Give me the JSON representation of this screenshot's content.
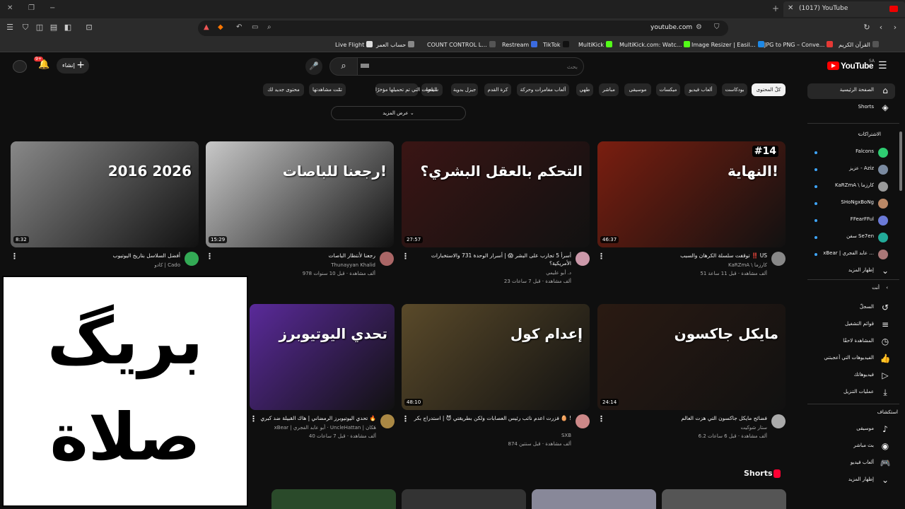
{
  "browser": {
    "tab_title": "(1017) YouTube",
    "url": "youtube.com",
    "bookmarks": [
      {
        "label": "Live Flight",
        "color": "#ddd"
      },
      {
        "label": "حساب العمر",
        "color": "#888"
      },
      {
        "label": "COUNT CONTROL L...",
        "color": "#555"
      },
      {
        "label": "Restream",
        "color": "#3b6be0"
      },
      {
        "label": "TikTok",
        "color": "#111"
      },
      {
        "label": "MultiKick",
        "color": "#53fc18"
      },
      {
        "label": "MultiKick.com: Watc...",
        "color": "#53fc18"
      },
      {
        "label": "Image Resizer | Easil...",
        "color": "#1e88e5"
      },
      {
        "label": "JPG to PNG – Conve...",
        "color": "#e53935"
      },
      {
        "label": "القرآن الكريم",
        "color": "#555"
      }
    ]
  },
  "header": {
    "notif_count": "9+",
    "create_label": "إنشاء",
    "search_placeholder": "بحث",
    "logo_text": "YouTube",
    "country_code": "SA"
  },
  "chips": [
    {
      "label": "كلّ المحتوى",
      "active": true
    },
    {
      "label": "بودكاست"
    },
    {
      "label": "ألعاب فيديو"
    },
    {
      "label": "ميكسات"
    },
    {
      "label": "موسيقى"
    },
    {
      "label": "مباشر"
    },
    {
      "label": "طهي"
    },
    {
      "label": "ألعاب مغامرات وحركة"
    },
    {
      "label": "كرة القدم"
    },
    {
      "label": "جيزل بدوية"
    },
    {
      "label": "سياحة"
    },
    {
      "label": "الفنوات التي تم تحميلها مؤخرًا"
    },
    {
      "label": "تمّت مشاهدتها"
    },
    {
      "label": "محتوى جديد لك"
    }
  ],
  "more_label": "عرض المزيد",
  "sidebar": {
    "main": [
      {
        "label": "الصفحة الرئيسية",
        "icon": "home-icon",
        "glyph": "⌂"
      },
      {
        "label": "Shorts",
        "icon": "shorts-icon",
        "glyph": "◈"
      }
    ],
    "subs_title": "الاشتراكات",
    "subscriptions": [
      {
        "label": "Falcons",
        "color": "#2ecc71"
      },
      {
        "label": "عزيز - Aziz",
        "color": "#7a8aa0"
      },
      {
        "label": "KaRZmA \\ كارزما",
        "color": "#999"
      },
      {
        "label": "SHoNgxBoNg",
        "color": "#b86"
      },
      {
        "label": "FFearFFul",
        "color": "#6b7ad8"
      },
      {
        "label": "سفن Se7en",
        "color": "#2a9"
      },
      {
        "label": "xBear | عابد الفجري ...",
        "color": "#a77"
      }
    ],
    "show_more": "إظهار المزيد",
    "you_title": "أنت",
    "you": [
      {
        "label": "السجلّ",
        "glyph": "↺"
      },
      {
        "label": "قوائم التشغيل",
        "glyph": "≡"
      },
      {
        "label": "المشاهدة لاحقًا",
        "glyph": "◷"
      },
      {
        "label": "الفيديوهات التي أعجبتني",
        "glyph": "👍"
      },
      {
        "label": "فيديوهاتك",
        "glyph": "▷"
      },
      {
        "label": "عمليات التنزيل",
        "glyph": "⤓"
      }
    ],
    "explore_title": "استكشاف",
    "explore": [
      {
        "label": "موسيقى",
        "glyph": "♪"
      },
      {
        "label": "بث مباشر",
        "glyph": "◉"
      },
      {
        "label": "ألعاب فيديو",
        "glyph": "🎮"
      },
      {
        "label": "إظهار المزيد",
        "glyph": "⌄"
      }
    ]
  },
  "videos": [
    {
      "title": "توقفت سلسلة الكرهان والسبب ‼️ US",
      "channel": "KaRZmA \\ كارزما",
      "stats": "51 ألف مشاهدة · قبل 11 ساعة",
      "duration": "46:37",
      "art": "النهاية!",
      "badge": "#14",
      "bg": "#7a1e10",
      "avatar": "#888"
    },
    {
      "title": "أسرأ 5 تجارب على البشر 😱 | أسرار الوحدة 731 والاستخبارات الأمريكية؟",
      "channel": "د. أبو عليمي",
      "stats": "23 ألف مشاهدة · قبل 7 ساعات",
      "duration": "27:57",
      "art": "التحكم بالعقل البشري؟",
      "badge": "",
      "bg": "#3a1514",
      "avatar": "#c9a"
    },
    {
      "title": "رجعنا لأنتظار الباصات",
      "channel": "Thunayyan Khalid",
      "stats": "978 ألف مشاهدة · قبل 10 سنوات",
      "duration": "15:29",
      "art": "رجعنا للباصات!",
      "badge": "",
      "bg": "#c8c8c8",
      "avatar": "#a66"
    },
    {
      "title": "أفضل السلاسل بتاريخ اليوتيوب",
      "channel": "كادو | Cado",
      "stats": "",
      "duration": "8:32",
      "art": "2016  2026",
      "badge": "",
      "bg": "#888",
      "avatar": "#3a5"
    },
    {
      "title": "فضائح مايكل جاكسون التي هزت العالم",
      "channel": "ستار شوكيت",
      "stats": "6.2 ألف مشاهدة · قبل 6 ساعات",
      "duration": "24:14",
      "art": "مايكل جاكسون",
      "badge": "",
      "bg": "#2a1a12",
      "avatar": "#aaa"
    },
    {
      "title": "فزرت اعدم نائب رئيس العصابات ولكن بطريقتي 😈 | استدراج بكر 🥚 !",
      "channel": "SXB",
      "stats": "874 ألف مشاهدة · قبل سنتين",
      "duration": "48:10",
      "art": "إعدام كول",
      "badge": "",
      "bg": "#5a4a2a",
      "avatar": "#c88"
    },
    {
      "title": "تحدي اليوتيوبرز الرمضاني | هاك القبيلة ضد كبري 🔥",
      "channel": "xBear | أبو عابد الفجري · UncleHattan | هَكان",
      "stats": "40 ألف مشاهدة · قبل 7 ساعات",
      "duration": "",
      "art": "تحدي اليوتيوبرز",
      "badge": "",
      "bg": "#5a2a9a",
      "avatar": "#a84"
    }
  ],
  "overlay": {
    "line1": "بريگ",
    "line2": "صلاة"
  },
  "shorts_title": "Shorts",
  "colors": {
    "accent": "#ff0000",
    "background": "#0f0f0f",
    "surface": "#272727"
  }
}
